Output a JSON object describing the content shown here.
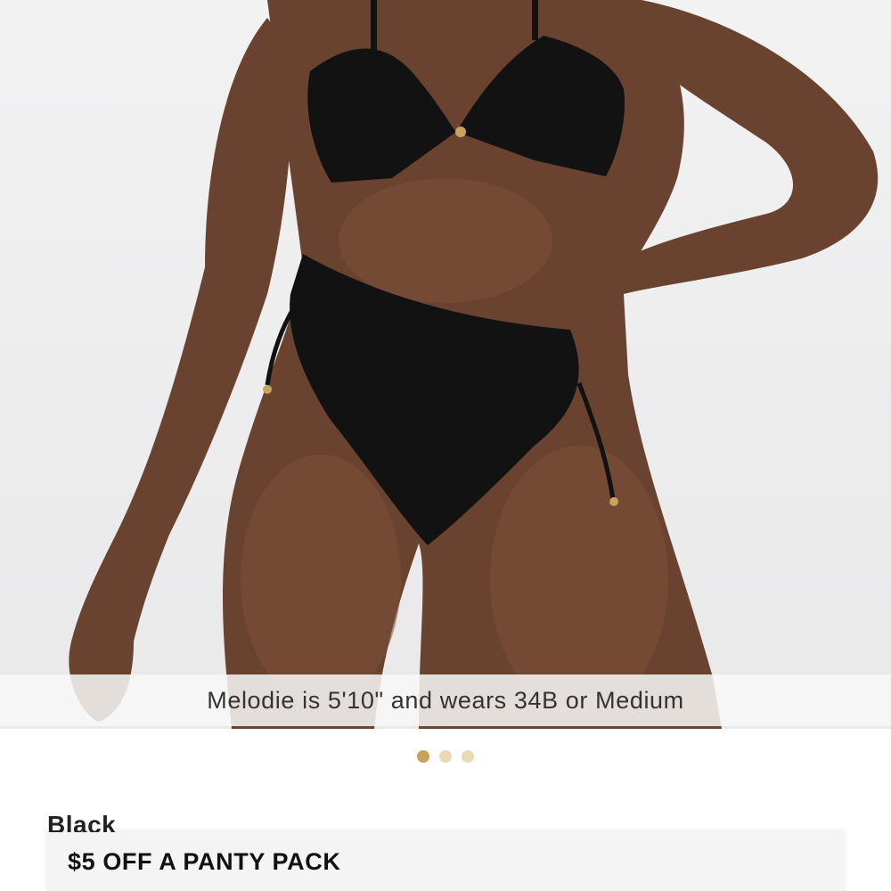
{
  "product": {
    "image_alt": "Model wearing black bikini",
    "model_caption": "Melodie is 5'10\" and wears 34B or Medium",
    "selected_color": "Black"
  },
  "carousel": {
    "total": 3,
    "active_index": 0,
    "active_color": "#c8a25a",
    "inactive_color": "#ead9b7"
  },
  "promo": {
    "text": "$5 OFF A PANTY PACK"
  }
}
